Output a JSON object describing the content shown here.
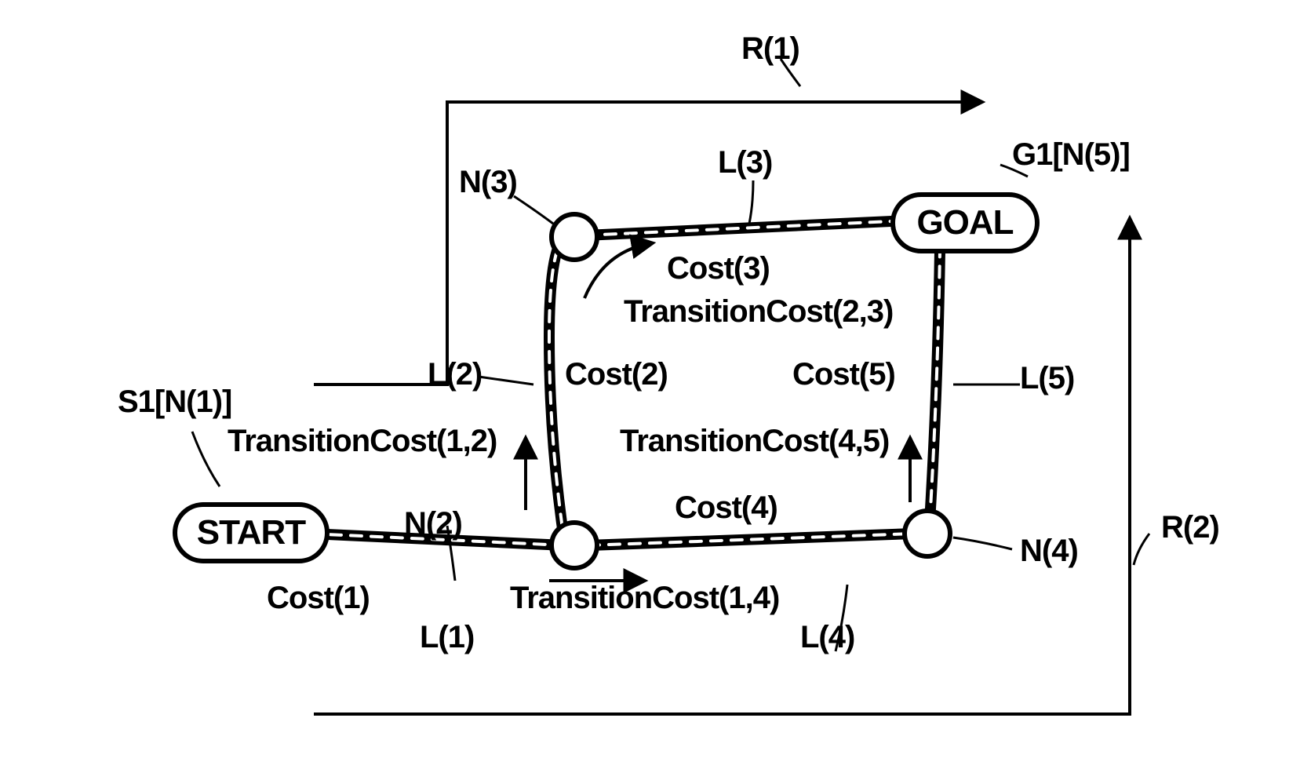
{
  "labels": {
    "R1": "R(1)",
    "R2": "R(2)",
    "G1": "G1[N(5)]",
    "S1": "S1[N(1)]",
    "GOAL": "GOAL",
    "START": "START",
    "N2": "N(2)",
    "N3": "N(3)",
    "N4": "N(4)",
    "L1": "L(1)",
    "L2": "L(2)",
    "L3": "L(3)",
    "L4": "L(4)",
    "L5": "L(5)",
    "Cost1": "Cost(1)",
    "Cost2": "Cost(2)",
    "Cost3": "Cost(3)",
    "Cost4": "Cost(4)",
    "Cost5": "Cost(5)",
    "TC12": "TransitionCost(1,2)",
    "TC14": "TransitionCost(1,4)",
    "TC23": "TransitionCost(2,3)",
    "TC45": "TransitionCost(4,5)"
  },
  "chart_data": {
    "type": "graph",
    "title": "Routing / path-cost diagram",
    "nodes": [
      {
        "id": "N1",
        "name": "START",
        "alias": "S1[N(1)]"
      },
      {
        "id": "N2",
        "name": "N(2)"
      },
      {
        "id": "N3",
        "name": "N(3)"
      },
      {
        "id": "N4",
        "name": "N(4)"
      },
      {
        "id": "N5",
        "name": "GOAL",
        "alias": "G1[N(5)]"
      }
    ],
    "edges": [
      {
        "id": "L1",
        "from": "N1",
        "to": "N2",
        "cost": "Cost(1)"
      },
      {
        "id": "L2",
        "from": "N2",
        "to": "N3",
        "cost": "Cost(2)",
        "transition": "TransitionCost(1,2)"
      },
      {
        "id": "L3",
        "from": "N3",
        "to": "N5",
        "cost": "Cost(3)",
        "transition": "TransitionCost(2,3)"
      },
      {
        "id": "L4",
        "from": "N2",
        "to": "N4",
        "cost": "Cost(4)",
        "transition": "TransitionCost(1,4)"
      },
      {
        "id": "L5",
        "from": "N4",
        "to": "N5",
        "cost": "Cost(5)",
        "transition": "TransitionCost(4,5)"
      }
    ],
    "routes": [
      {
        "id": "R1",
        "sequence": [
          "N1",
          "N2",
          "N3",
          "N5"
        ]
      },
      {
        "id": "R2",
        "sequence": [
          "N1",
          "N2",
          "N4",
          "N5"
        ]
      }
    ]
  }
}
